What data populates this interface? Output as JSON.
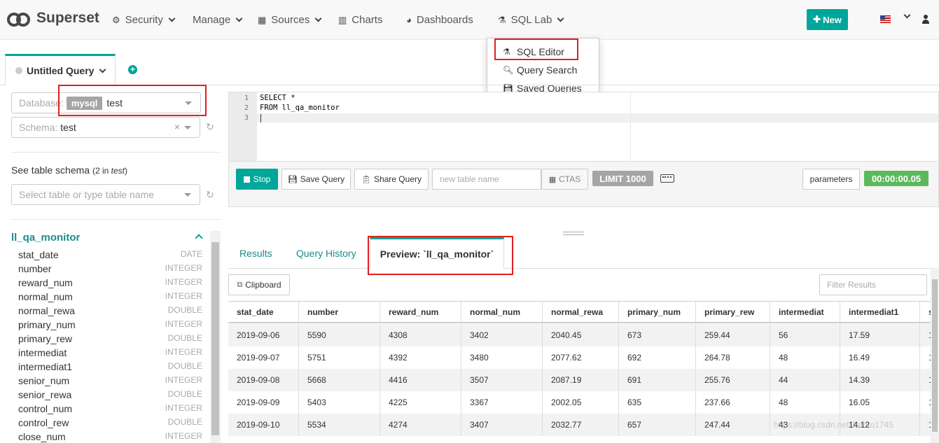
{
  "nav": {
    "brand": "Superset",
    "items": [
      "Security",
      "Manage",
      "Sources",
      "Charts",
      "Dashboards",
      "SQL Lab"
    ],
    "new_label": "New"
  },
  "sqllab_menu": [
    "SQL Editor",
    "Query Search",
    "Saved Queries"
  ],
  "query_tab": {
    "title": "Untitled Query"
  },
  "left": {
    "database_label": "Database:",
    "database_engine": "mysql",
    "database_value": "test",
    "schema_label": "Schema:",
    "schema_value": "test",
    "clear_label": "×",
    "see_schema": "See table schema",
    "see_schema_count": "(2 in",
    "see_schema_db": "test",
    "see_schema_close": ")",
    "table_placeholder": "Select table or type table name",
    "table_name": "ll_qa_monitor",
    "columns": [
      {
        "name": "stat_date",
        "type": "DATE"
      },
      {
        "name": "number",
        "type": "INTEGER"
      },
      {
        "name": "reward_num",
        "type": "INTEGER"
      },
      {
        "name": "normal_num",
        "type": "INTEGER"
      },
      {
        "name": "normal_rewa",
        "type": "DOUBLE"
      },
      {
        "name": "primary_num",
        "type": "INTEGER"
      },
      {
        "name": "primary_rew",
        "type": "DOUBLE"
      },
      {
        "name": "intermediat",
        "type": "INTEGER"
      },
      {
        "name": "intermediat1",
        "type": "DOUBLE"
      },
      {
        "name": "senior_num",
        "type": "INTEGER"
      },
      {
        "name": "senior_rewa",
        "type": "DOUBLE"
      },
      {
        "name": "control_num",
        "type": "INTEGER"
      },
      {
        "name": "control_rew",
        "type": "DOUBLE"
      },
      {
        "name": "close_num",
        "type": "INTEGER"
      }
    ]
  },
  "editor": {
    "line_numbers": [
      "1",
      "2",
      "3"
    ],
    "lines": [
      "SELECT *",
      "FROM ll_qa_monitor",
      ""
    ]
  },
  "toolbar": {
    "stop": "Stop",
    "save": "Save Query",
    "share": "Share Query",
    "table_placeholder": "new table name",
    "ctas": "CTAS",
    "limit": "LIMIT 1000",
    "parameters": "parameters",
    "timer": "00:00:00.05"
  },
  "results": {
    "tabs": [
      "Results",
      "Query History"
    ],
    "active_tab": "Preview: `ll_qa_monitor`",
    "clipboard": "Clipboard",
    "filter_placeholder": "Filter Results",
    "headers": [
      "stat_date",
      "number",
      "reward_num",
      "normal_num",
      "normal_rewa",
      "primary_num",
      "primary_rew",
      "intermediat",
      "intermediat1",
      "s"
    ],
    "rows": [
      [
        "2019-09-06",
        "5590",
        "4308",
        "3402",
        "2040.45",
        "673",
        "259.44",
        "56",
        "17.59",
        "1"
      ],
      [
        "2019-09-07",
        "5751",
        "4392",
        "3480",
        "2077.62",
        "692",
        "264.78",
        "48",
        "16.49",
        "1"
      ],
      [
        "2019-09-08",
        "5668",
        "4416",
        "3507",
        "2087.19",
        "691",
        "255.76",
        "44",
        "14.39",
        "1"
      ],
      [
        "2019-09-09",
        "5403",
        "4225",
        "3367",
        "2002.05",
        "635",
        "237.66",
        "48",
        "16.05",
        "1"
      ],
      [
        "2019-09-10",
        "5534",
        "4274",
        "3407",
        "2032.77",
        "657",
        "247.44",
        "43",
        "14.12",
        "1"
      ]
    ]
  },
  "watermark": "https://blog.csdn.net/Totoro1745",
  "colors": {
    "accent": "#00a699",
    "highlight": "#e02020",
    "timer": "#5cb85c"
  }
}
